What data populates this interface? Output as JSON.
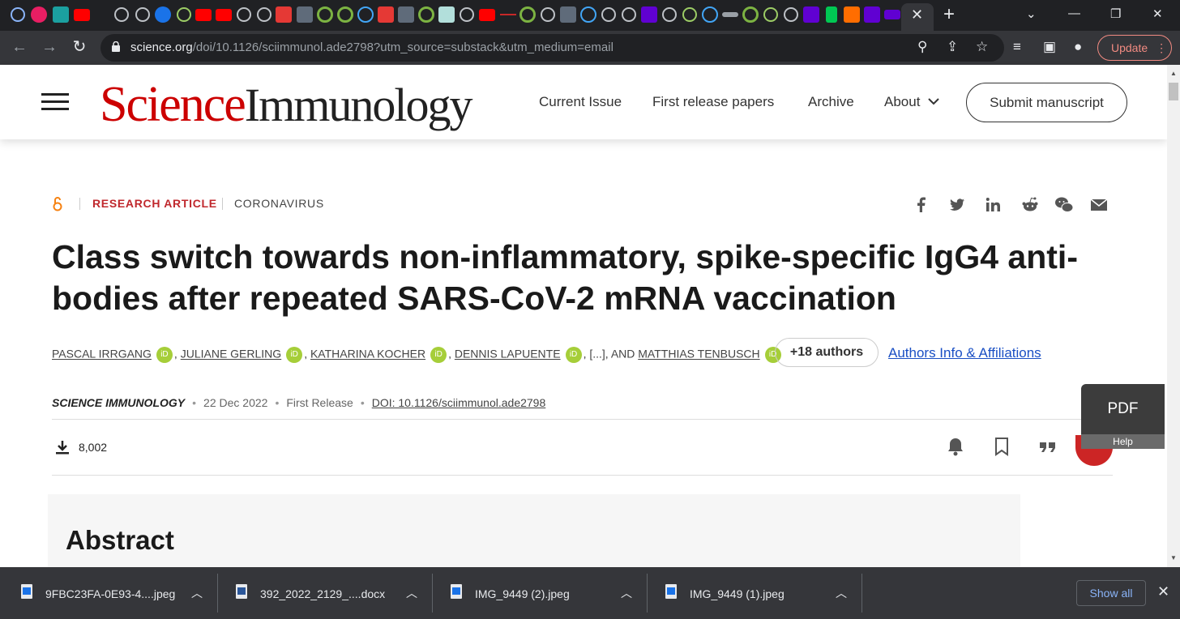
{
  "browser": {
    "tab_close": "✕",
    "new_tab": "+",
    "url_host": "science.org",
    "url_path": "/doi/10.1126/sciimmunol.ade2798?utm_source=substack&utm_medium=email",
    "update_label": "Update"
  },
  "site": {
    "logo_science": "Science",
    "logo_immunology": "Immunology",
    "nav": [
      "Current Issue",
      "First release papers",
      "Archive",
      "About"
    ],
    "submit_label": "Submit manuscript"
  },
  "article": {
    "type": "RESEARCH ARTICLE",
    "subject": "CORONAVIRUS",
    "title": "Class switch towards non-inflammatory, spike-specific IgG4 anti-bodies after repeated SARS-CoV-2 mRNA vaccination",
    "authors": [
      "PASCAL IRRGANG",
      "JULIANE GERLING",
      "KATHARINA KOCHER",
      "DENNIS LAPUENTE",
      "MATTHIAS TENBUSCH"
    ],
    "ellipsis": "[...]",
    "and_text": "AND",
    "more_authors": "+18 authors",
    "affiliations_link": "Authors Info & Affiliations",
    "journal": "SCIENCE IMMUNOLOGY",
    "date": "22 Dec 2022",
    "release": "First Release",
    "doi": "DOI: 10.1126/sciimmunol.ade2798",
    "download_count": "8,002",
    "abstract_heading": "Abstract"
  },
  "pdf_widget": {
    "label": "PDF",
    "help": "Help"
  },
  "downloads": {
    "items": [
      "9FBC23FA-0E93-4....jpeg",
      "392_2022_2129_....docx",
      "IMG_9449 (2).jpeg",
      "IMG_9449 (1).jpeg"
    ],
    "show_all": "Show all",
    "close": "✕"
  },
  "colors": {
    "brand_red": "#c0282d",
    "link_blue": "#1a4fc4",
    "orcid_green": "#a6ce39"
  }
}
